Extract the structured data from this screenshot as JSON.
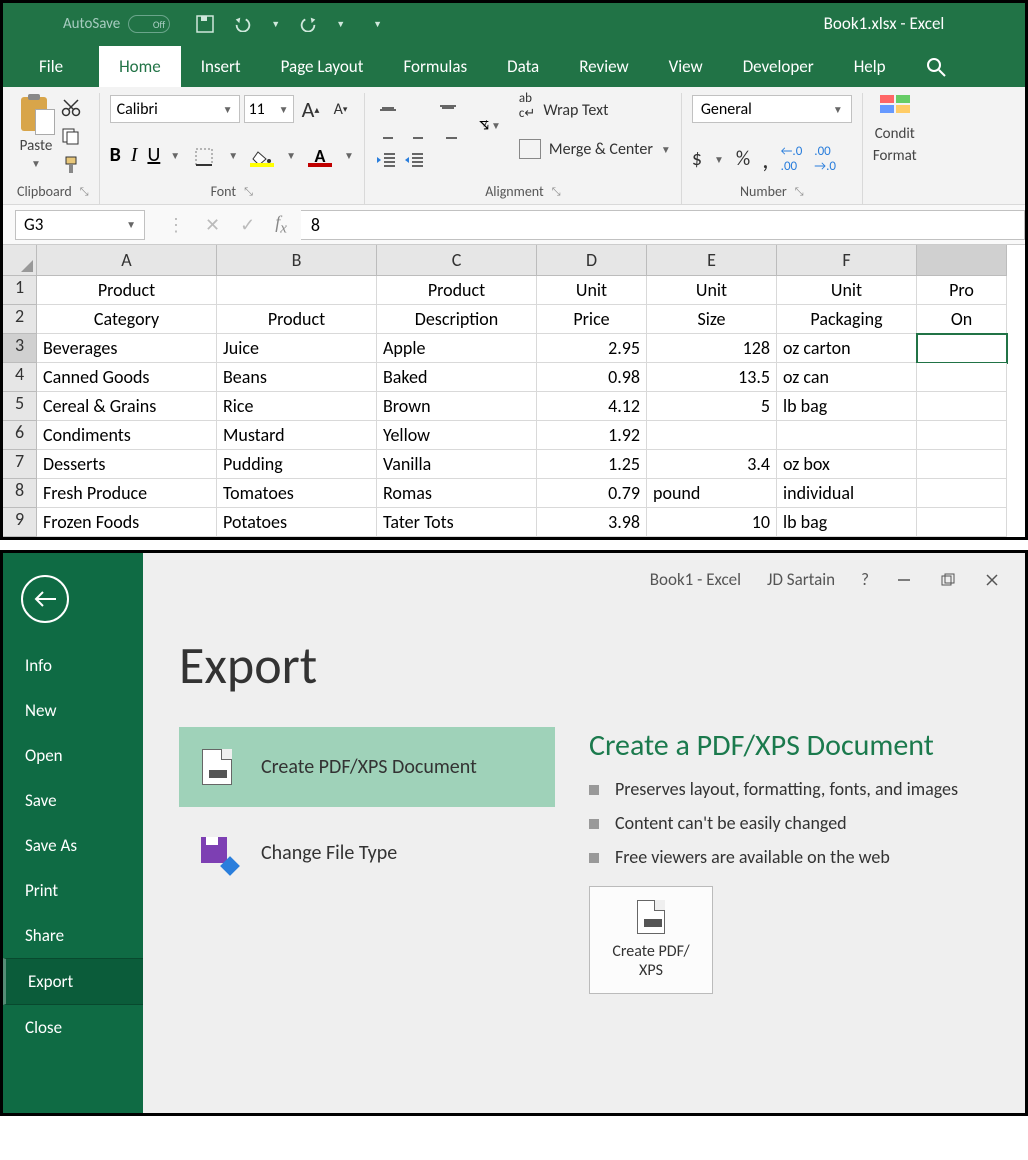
{
  "titlebar": {
    "autosave": "AutoSave",
    "autosave_state": "Off",
    "document_title": "Book1.xlsx  -  Excel"
  },
  "tabs": [
    "File",
    "Home",
    "Insert",
    "Page Layout",
    "Formulas",
    "Data",
    "Review",
    "View",
    "Developer",
    "Help"
  ],
  "active_tab": "Home",
  "ribbon": {
    "clipboard": {
      "label": "Clipboard",
      "paste": "Paste"
    },
    "font": {
      "label": "Font",
      "name": "Calibri",
      "size": "11"
    },
    "alignment": {
      "label": "Alignment",
      "wrap": "Wrap Text",
      "merge": "Merge & Center"
    },
    "number": {
      "label": "Number",
      "format": "General"
    },
    "styles": {
      "cond1": "Condit",
      "cond2": "Format"
    }
  },
  "formula_bar": {
    "namebox": "G3",
    "value": "8"
  },
  "columns": [
    "A",
    "B",
    "C",
    "D",
    "E",
    "F",
    ""
  ],
  "header_row1": [
    "Product",
    "",
    "Product",
    "Unit",
    "Unit",
    "Unit",
    "Pro"
  ],
  "header_row2": [
    "Category",
    "Product",
    "Description",
    "Price",
    "Size",
    "Packaging",
    "On "
  ],
  "rows": [
    {
      "n": "3",
      "a": "Beverages",
      "b": "Juice",
      "c": "Apple",
      "d": "2.95",
      "e": "128",
      "f": "oz carton",
      "g": ""
    },
    {
      "n": "4",
      "a": "Canned Goods",
      "b": "Beans",
      "c": "Baked",
      "d": "0.98",
      "e": "13.5",
      "f": "oz can",
      "g": ""
    },
    {
      "n": "5",
      "a": "Cereal & Grains",
      "b": "Rice",
      "c": "Brown",
      "d": "4.12",
      "e": "5",
      "f": "lb bag",
      "g": ""
    },
    {
      "n": "6",
      "a": "Condiments",
      "b": "Mustard",
      "c": "Yellow",
      "d": "1.92",
      "e": "",
      "f": "",
      "g": ""
    },
    {
      "n": "7",
      "a": "Desserts",
      "b": "Pudding",
      "c": "Vanilla",
      "d": "1.25",
      "e": "3.4",
      "f": "oz box",
      "g": ""
    },
    {
      "n": "8",
      "a": "Fresh Produce",
      "b": "Tomatoes",
      "c": "Romas",
      "d": "0.79",
      "e": "pound",
      "f": "individual",
      "g": ""
    },
    {
      "n": "9",
      "a": "Frozen Foods",
      "b": "Potatoes",
      "c": "Tater Tots",
      "d": "3.98",
      "e": "10",
      "f": "lb bag",
      "g": ""
    }
  ],
  "backstage": {
    "topbar": {
      "doc": "Book1  -  Excel",
      "user": "JD Sartain"
    },
    "menu": [
      "Info",
      "New",
      "Open",
      "Save",
      "Save As",
      "Print",
      "Share",
      "Export",
      "Close"
    ],
    "active": "Export",
    "title": "Export",
    "option1": "Create PDF/XPS Document",
    "option2": "Change File Type",
    "right_head": "Create a PDF/XPS Document",
    "bullets": [
      "Preserves layout, formatting, fonts, and images",
      "Content can't be easily changed",
      "Free viewers are available on the web"
    ],
    "create_btn1": "Create PDF/",
    "create_btn2": "XPS"
  }
}
